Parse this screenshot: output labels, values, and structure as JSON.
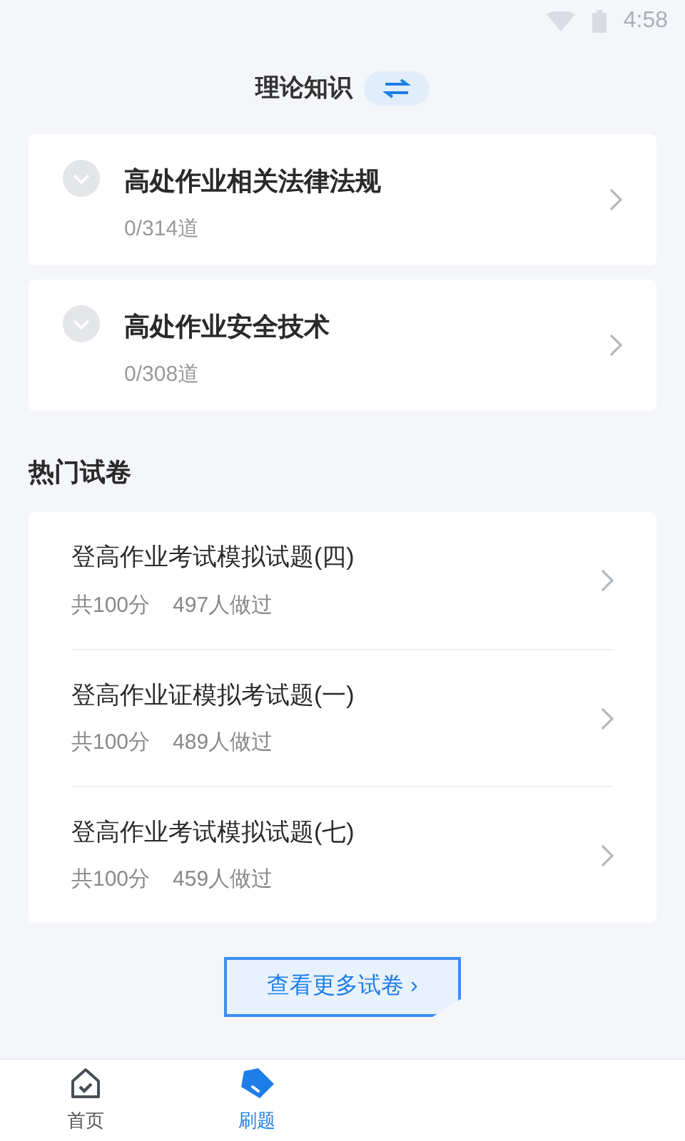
{
  "status_bar": {
    "time": "4:58"
  },
  "header": {
    "title": "理论知识"
  },
  "categories": [
    {
      "title": "高处作业相关法律法规",
      "progress": "0/314道"
    },
    {
      "title": "高处作业安全技术",
      "progress": "0/308道"
    }
  ],
  "hot_papers": {
    "title": "热门试卷",
    "items": [
      {
        "title": "登高作业考试模拟试题(四)",
        "score": "共100分",
        "count": "497人做过"
      },
      {
        "title": "登高作业证模拟考试题(一)",
        "score": "共100分",
        "count": "489人做过"
      },
      {
        "title": "登高作业考试模拟试题(七)",
        "score": "共100分",
        "count": "459人做过"
      }
    ]
  },
  "more_button": {
    "label": "查看更多试卷 ›"
  },
  "tab_bar": [
    {
      "label": "首页",
      "selected": false,
      "kind": "home"
    },
    {
      "label": "刷题",
      "selected": true,
      "kind": "practice"
    }
  ]
}
